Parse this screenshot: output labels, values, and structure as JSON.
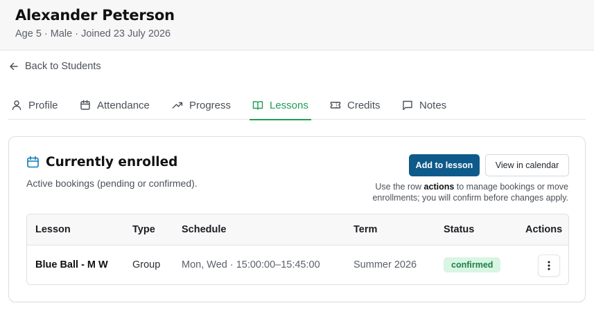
{
  "student": {
    "name": "Alexander Peterson",
    "meta": "Age 5 · Male · Joined 23 July 2026"
  },
  "nav": {
    "back_label": "Back to Students"
  },
  "tabs": [
    {
      "label": "Profile",
      "icon": "user-icon"
    },
    {
      "label": "Attendance",
      "icon": "calendar-icon"
    },
    {
      "label": "Progress",
      "icon": "trending-up-icon"
    },
    {
      "label": "Lessons",
      "icon": "book-open-icon",
      "active": true
    },
    {
      "label": "Credits",
      "icon": "ticket-icon"
    },
    {
      "label": "Notes",
      "icon": "message-square-icon"
    }
  ],
  "enrolled": {
    "title": "Currently enrolled",
    "subtitle": "Active bookings (pending or confirmed).",
    "add_button": "Add to lesson",
    "calendar_button": "View in calendar",
    "hint_before": "Use the row ",
    "hint_bold": "actions",
    "hint_after": " to manage bookings or move enrollments; you will confirm before changes apply.",
    "columns": [
      "Lesson",
      "Type",
      "Schedule",
      "Term",
      "Status",
      "Actions"
    ],
    "rows": [
      {
        "lesson": "Blue Ball - M W",
        "type": "Group",
        "schedule": "Mon, Wed · 15:00:00–15:45:00",
        "term": "Summer 2026",
        "status": "confirmed"
      }
    ]
  },
  "colors": {
    "accent_green": "#1f9d55",
    "primary_button": "#0e5a8a",
    "badge_bg": "#d9f5e3",
    "badge_text": "#1a7f45"
  }
}
